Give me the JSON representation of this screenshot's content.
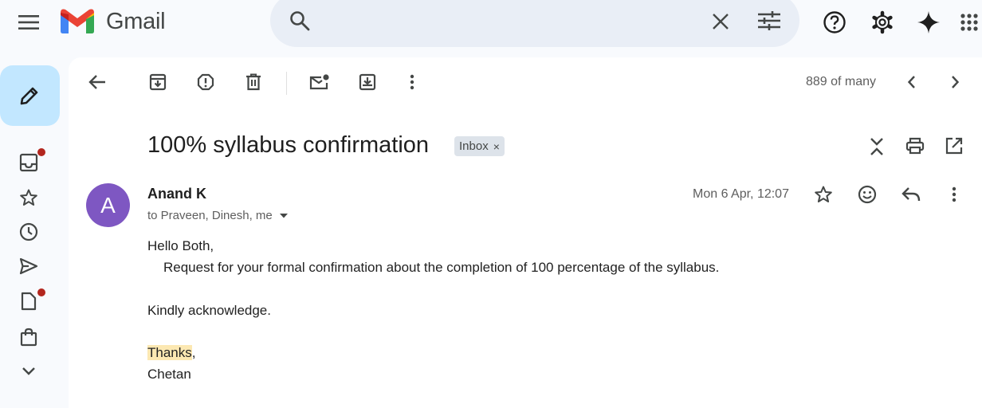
{
  "app": {
    "name": "Gmail"
  },
  "toolbar": {
    "counter": "889 of many"
  },
  "email": {
    "subject": "100% syllabus confirmation",
    "label": "Inbox",
    "label_remove": "×",
    "avatar_letter": "A",
    "sender": "Anand K",
    "recipients": "to Praveen, Dinesh, me",
    "date": "Mon 6 Apr, 12:07",
    "body": {
      "greeting": "Hello Both,",
      "request": "Request for your formal confirmation about the completion of 100 percentage of the syllabus.",
      "ack": "Kindly acknowledge.",
      "thanks": "Thanks",
      "thanks_suffix": ",",
      "signature": "Chetan"
    }
  },
  "colors": {
    "background": "#f8fafd",
    "search_bg": "#e9eef6",
    "compose_bg": "#c2e7ff",
    "avatar": "#7e57c2",
    "notification_dot": "#b3261e",
    "highlight": "#fce8b2",
    "label_chip": "#dde3ea"
  },
  "icons": {
    "top": [
      "menu-icon",
      "gmail-logo",
      "search-icon",
      "clear-search-icon",
      "search-options-icon",
      "help-icon",
      "settings-icon",
      "gemini-icon",
      "apps-grid-icon"
    ],
    "rail": [
      "compose-pencil-icon",
      "inbox-icon",
      "star-icon",
      "clock-icon",
      "send-icon",
      "draft-icon",
      "shopping-bag-icon",
      "chevron-down-icon"
    ],
    "toolbar": [
      "back-arrow-icon",
      "archive-icon",
      "report-spam-icon",
      "delete-icon",
      "mark-unread-icon",
      "move-to-icon",
      "more-vert-icon",
      "prev-icon",
      "next-icon"
    ],
    "subject": [
      "expand-collapse-icon",
      "print-icon",
      "open-new-window-icon"
    ],
    "message": [
      "star-icon",
      "emoji-icon",
      "reply-icon",
      "more-vert-icon"
    ]
  }
}
